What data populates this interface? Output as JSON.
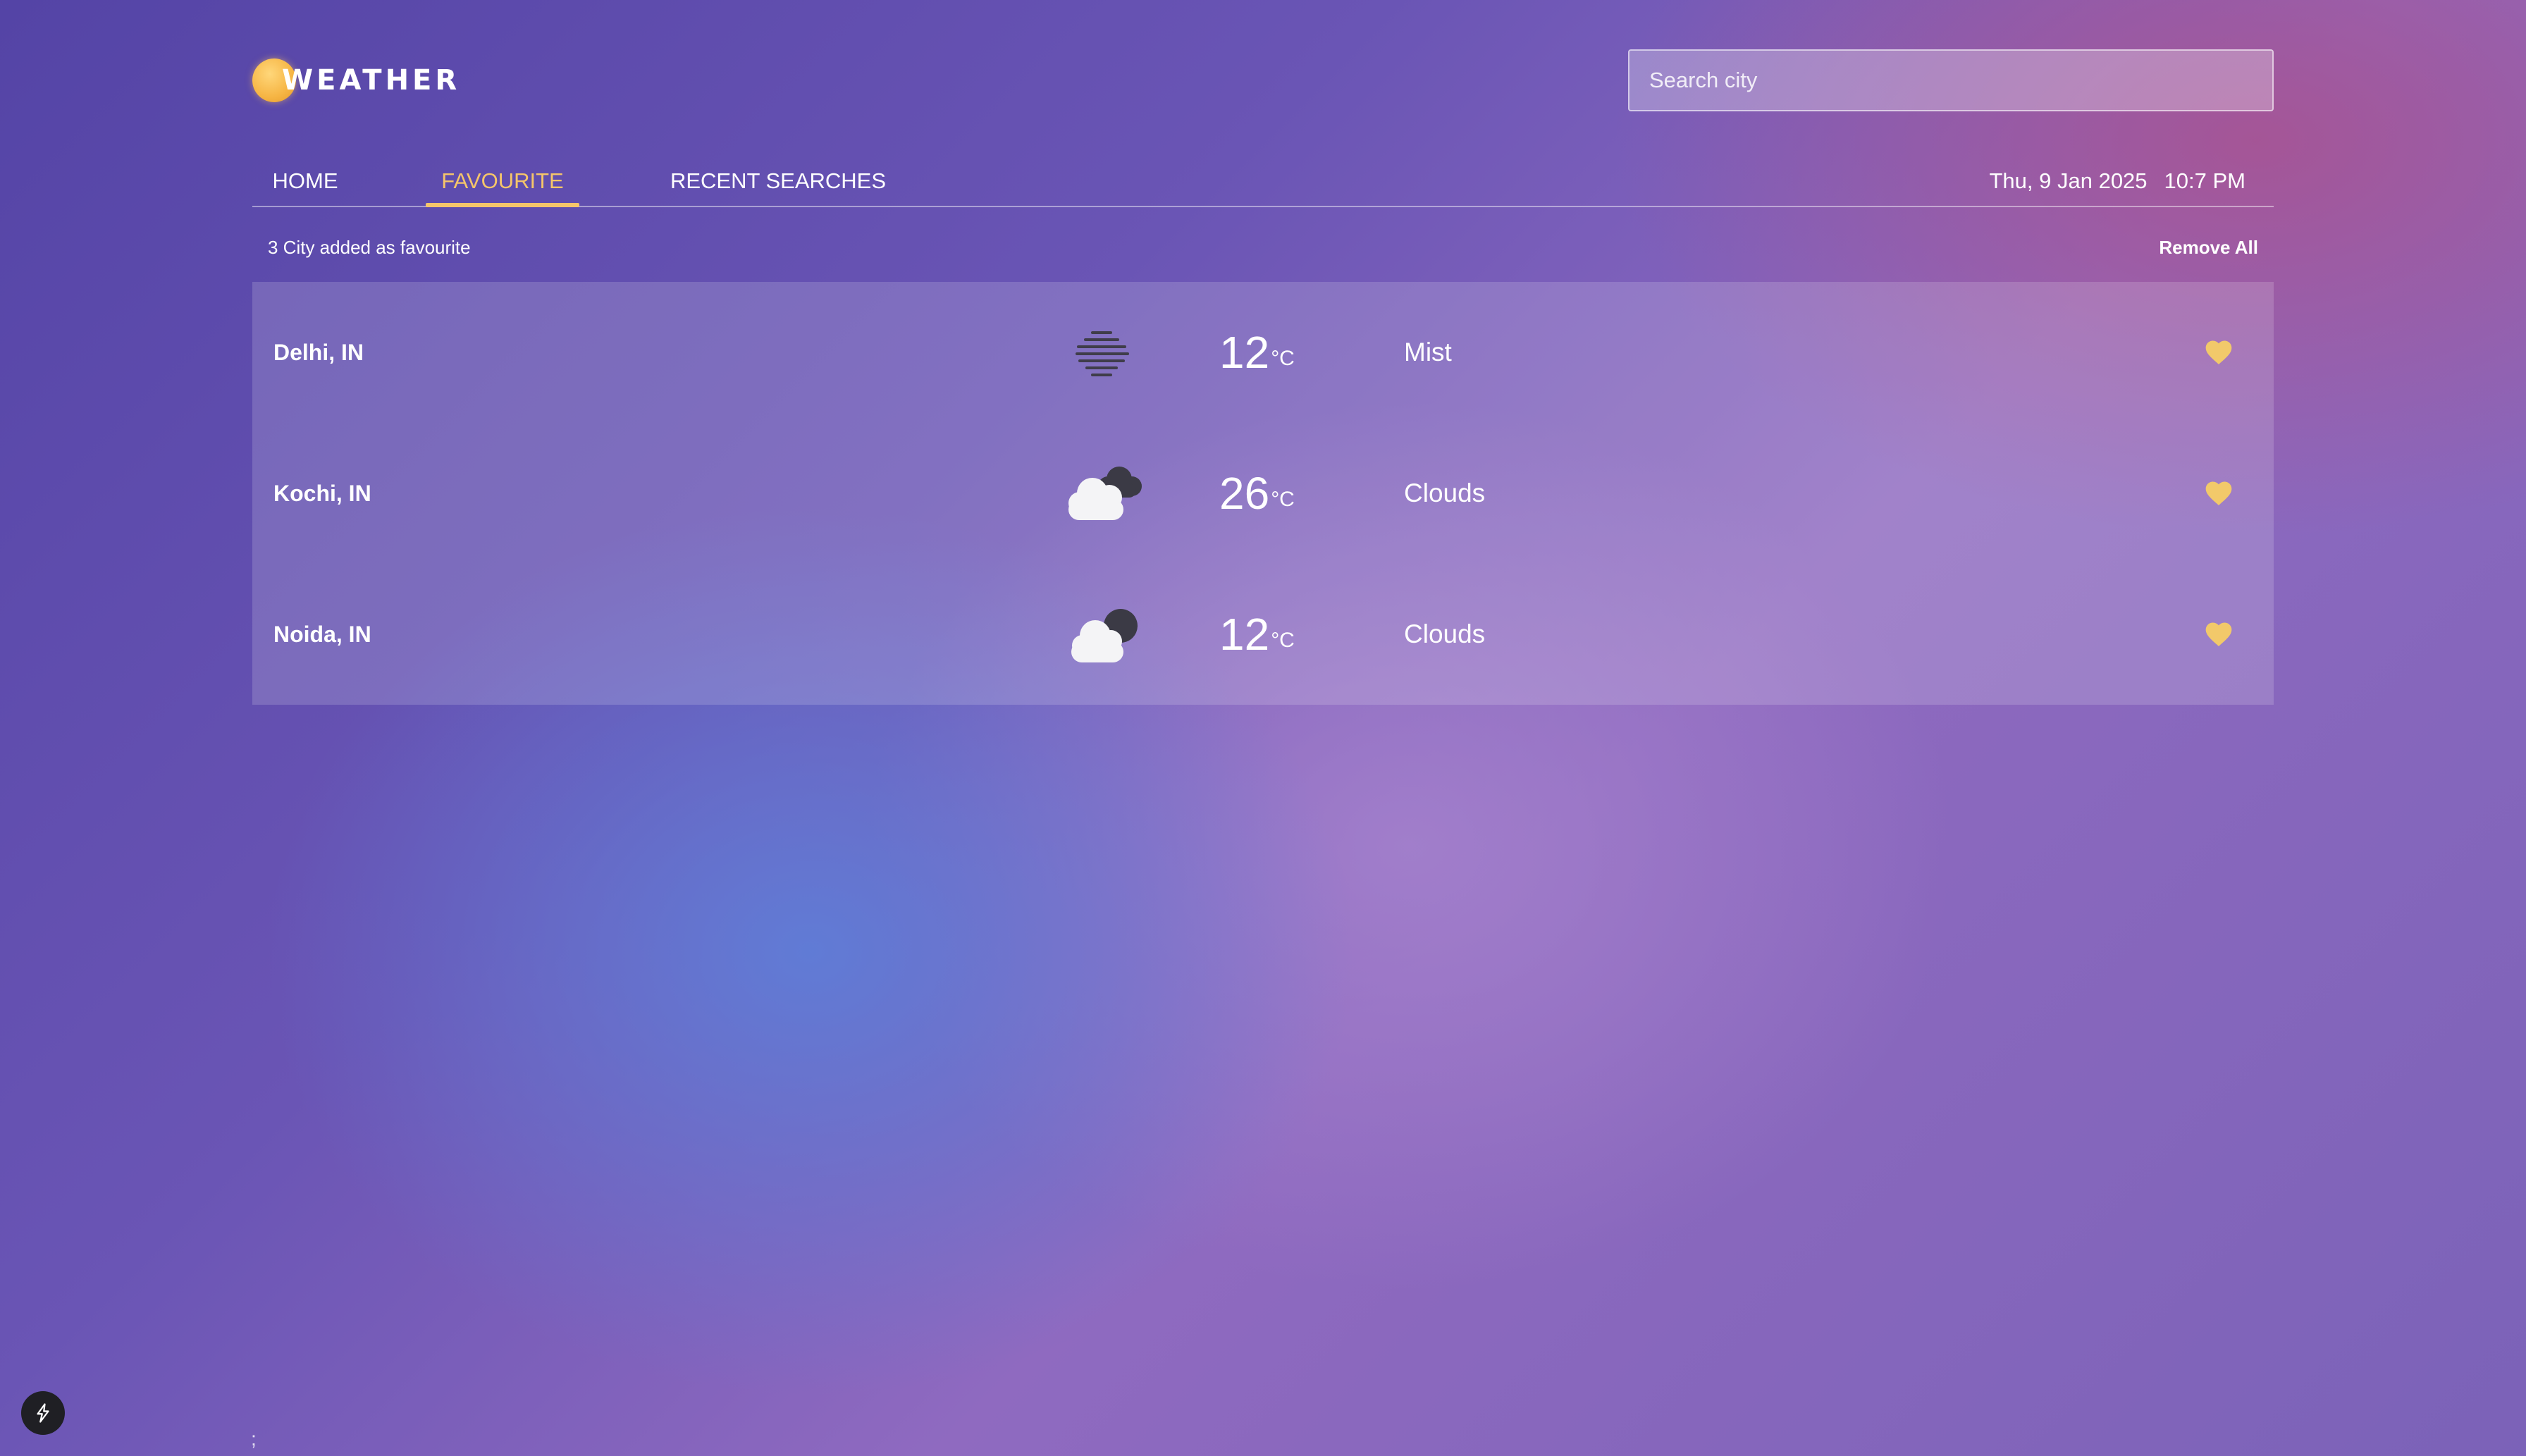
{
  "header": {
    "logo_text": "WEATHER",
    "search_placeholder": "Search city"
  },
  "nav": {
    "tabs": [
      {
        "label": "HOME",
        "active": false
      },
      {
        "label": "FAVOURITE",
        "active": true
      },
      {
        "label": "RECENT SEARCHES",
        "active": false
      }
    ],
    "date": "Thu, 9 Jan 2025",
    "time": "10:7 PM"
  },
  "favourites": {
    "count_text": "3 City added as favourite",
    "remove_all_label": "Remove All",
    "rows": [
      {
        "city": "Delhi, IN",
        "icon": "mist-icon",
        "temp": "12",
        "unit": "°C",
        "description": "Mist"
      },
      {
        "city": "Kochi, IN",
        "icon": "clouds-icon",
        "temp": "26",
        "unit": "°C",
        "description": "Clouds"
      },
      {
        "city": "Noida, IN",
        "icon": "clouds-icon",
        "temp": "12",
        "unit": "°C",
        "description": "Clouds"
      }
    ]
  },
  "footer": {
    "stray_text": ";"
  },
  "colors": {
    "accent": "#f5c56a",
    "heart": "#f2c96a"
  }
}
